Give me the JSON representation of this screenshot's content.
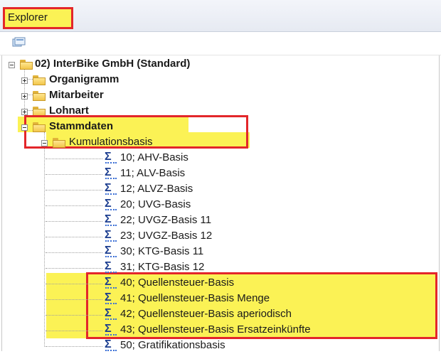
{
  "window": {
    "tab_label": "Explorer"
  },
  "toolbar": {
    "icon": "tree-view-icon"
  },
  "colors": {
    "highlight": "#fbf255",
    "highlight_border": "#e3262a",
    "sigma": "#1b3d8f",
    "folder": "#f2c64a"
  },
  "tree": {
    "root": "02) InterBike GmbH (Standard)",
    "nodes": {
      "organigramm": "Organigramm",
      "mitarbeiter": "Mitarbeiter",
      "lohnart": "Lohnart",
      "stammdaten": "Stammdaten",
      "kumulationsbasis": "Kumulationsbasis"
    },
    "items": [
      "10; AHV-Basis",
      "11; ALV-Basis",
      "12; ALVZ-Basis",
      "20; UVG-Basis",
      "22; UVGZ-Basis 11",
      "23; UVGZ-Basis 12",
      "30; KTG-Basis 11",
      "31; KTG-Basis 12",
      "40; Quellensteuer-Basis",
      "41; Quellensteuer-Basis Menge",
      "42; Quellensteuer-Basis aperiodisch",
      "43; Quellensteuer-Basis Ersatzeinkünfte",
      "50; Gratifikationsbasis"
    ]
  }
}
